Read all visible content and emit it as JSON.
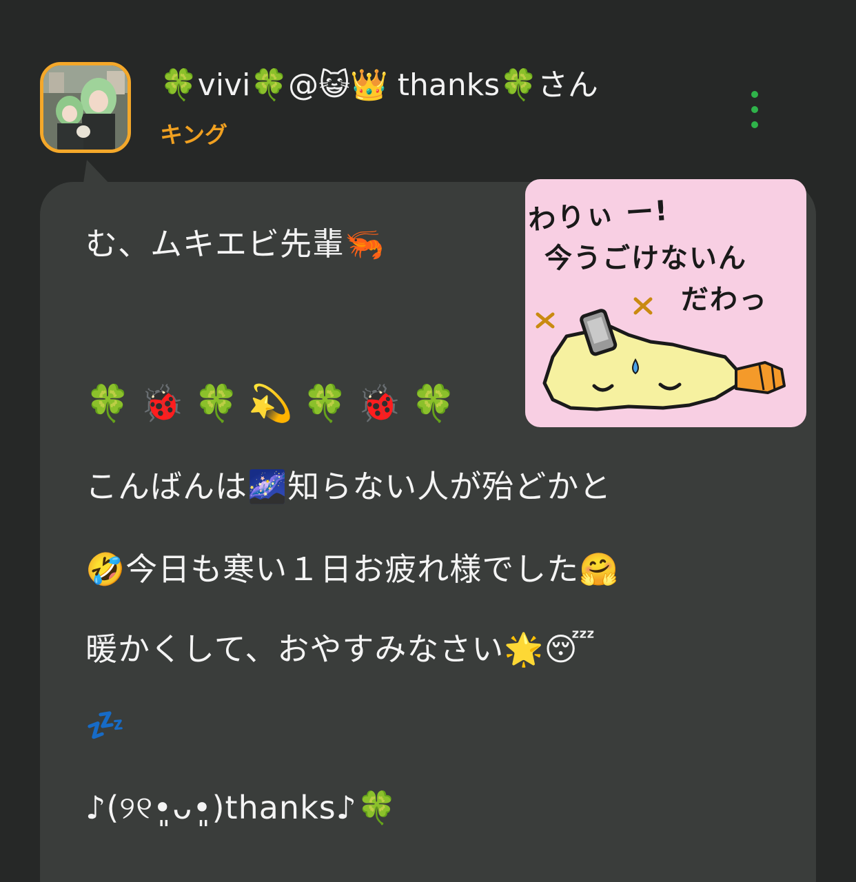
{
  "header": {
    "username": "🍀vivi🍀@😺👑 thanks🍀さん",
    "rank": "キング"
  },
  "message": {
    "lines": [
      "む、ムキエビ先輩🦐",
      "🍀🐞🍀💫🍀🐞🍀",
      "こんばんは🌌知らない人が殆どかと",
      "🤣今日も寒い１日お疲れ様でした🤗",
      "暖かくして、おやすみなさい🌟😴",
      "💤",
      "♪(୨୧•͈ᴗ•͈)thanks♪🍀"
    ]
  },
  "sticker": {
    "line1": "わりぃ ー!",
    "line2": "今うごけないん",
    "line3": "だわっ"
  },
  "colors": {
    "background": "#262827",
    "bubble": "#3a3d3b",
    "rank": "#f0a020",
    "avatar_border": "#f4a82a",
    "menu_dots": "#2fb34a",
    "sticker_bg": "#f8cfe3"
  },
  "icons": {
    "avatar": "avatar-image",
    "more": "more-vertical-icon"
  }
}
